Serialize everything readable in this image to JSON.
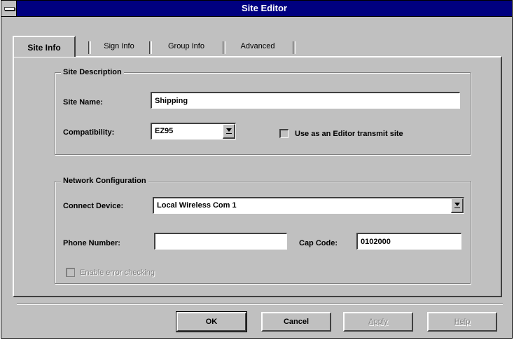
{
  "window": {
    "title": "Site Editor"
  },
  "tabs": [
    {
      "label": "Site Info",
      "active": true
    },
    {
      "label": "Sign Info",
      "active": false
    },
    {
      "label": "Group Info",
      "active": false
    },
    {
      "label": "Advanced",
      "active": false
    }
  ],
  "site_description": {
    "title": "Site Description",
    "site_name_label": "Site Name:",
    "site_name_value": "Shipping",
    "compatibility_label": "Compatibility:",
    "compatibility_value": "EZ95",
    "transmit_checkbox_label": "Use as an Editor transmit site",
    "transmit_checked": false
  },
  "network_configuration": {
    "title": "Network Configuration",
    "connect_device_label": "Connect Device:",
    "connect_device_value": "Local Wireless Com 1",
    "phone_number_label": "Phone Number:",
    "phone_number_value": "",
    "cap_code_label": "Cap Code:",
    "cap_code_value": "0102000",
    "error_checking_label": "Enable error checking",
    "error_checking_checked": false,
    "error_checking_enabled": false
  },
  "buttons": {
    "ok": "OK",
    "cancel": "Cancel",
    "apply": "Apply",
    "help": "Help"
  },
  "colors": {
    "titlebar": "#000080",
    "face": "#c0c0c0"
  },
  "icons": {
    "system_menu": "system-menu-icon",
    "dropdown": "dropdown-arrow-icon"
  }
}
